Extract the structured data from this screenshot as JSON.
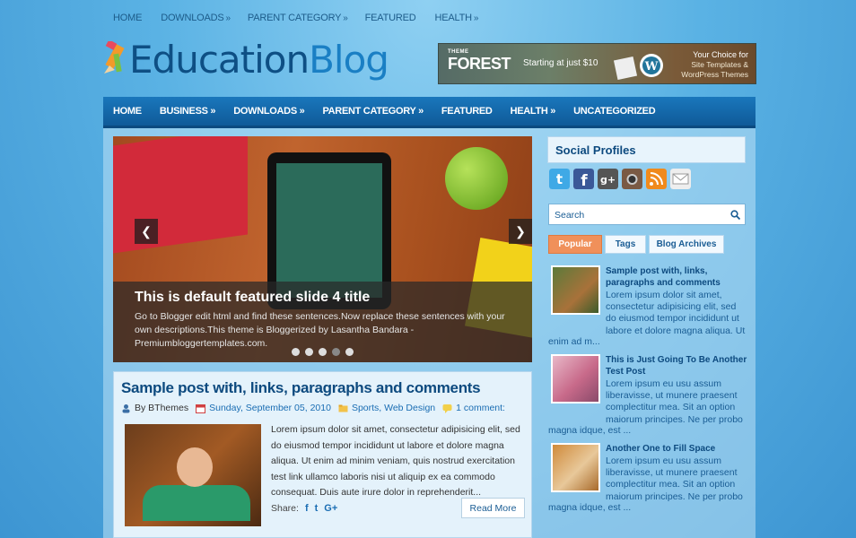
{
  "topnav": [
    {
      "label": "HOME",
      "arrow": ""
    },
    {
      "label": "DOWNLOADS",
      "arrow": "»"
    },
    {
      "label": "PARENT CATEGORY",
      "arrow": "»"
    },
    {
      "label": "FEATURED",
      "arrow": ""
    },
    {
      "label": "HEALTH",
      "arrow": "»"
    }
  ],
  "logo": {
    "part1": "Education",
    "part2": "Blog"
  },
  "ad": {
    "brand_small": "THEME",
    "brand_big": "FOREST",
    "start": "Starting at just $10",
    "choice_head": "Your Choice for",
    "choice_line1": "Site Templates &",
    "choice_line2": "WordPress Themes"
  },
  "mainnav": [
    "HOME",
    "BUSINESS »",
    "DOWNLOADS »",
    "PARENT CATEGORY »",
    "FEATURED",
    "HEALTH »",
    "UNCATEGORIZED"
  ],
  "slider": {
    "title": "This is default featured slide 4 title",
    "text": "Go to Blogger edit html and find these sentences.Now replace these sentences with your own descriptions.This theme is Bloggerized by Lasantha Bandara - Premiumbloggertemplates.com.",
    "left_arrow": "❮",
    "right_arrow": "❯",
    "dot_count": 5,
    "active_dot": 4
  },
  "post": {
    "title": "Sample post with, links, paragraphs and comments",
    "author": "By BThemes",
    "date": "Sunday, September 05, 2010",
    "categories": "Sports, Web Design",
    "comments": "1 comment:",
    "excerpt": "Lorem ipsum dolor sit amet, consectetur adipisicing elit, sed do eiusmod tempor incididunt ut labore et dolore magna aliqua. Ut enim ad minim veniam, quis nostrud exercitation test link ullamco laboris nisi ut aliquip ex ea commodo consequat. Duis aute irure dolor in reprehenderit...",
    "share_label": "Share:",
    "share_f": "f",
    "share_t": "t",
    "share_g": "G+",
    "read_more": "Read More"
  },
  "sidebar": {
    "social_title": "Social Profiles",
    "search_placeholder": "Search",
    "tabs": [
      "Popular",
      "Tags",
      "Blog Archives"
    ],
    "posts": [
      {
        "title": "Sample post with, links, paragraphs and comments",
        "text": "Lorem ipsum dolor sit amet, consectetur adipisicing elit, sed do eiusmod tempor incididunt ut labore et dolore magna aliqua. Ut",
        "tail": "enim ad m..."
      },
      {
        "title": "This is Just Going To Be Another Test Post",
        "text": "Lorem ipsum eu usu assum liberavisse, ut munere praesent complectitur mea. Sit an option maiorum principes. Ne per probo",
        "tail": "magna idque, est ..."
      },
      {
        "title": "Another One to Fill Space",
        "text": "Lorem ipsum eu usu assum liberavisse, ut munere praesent complectitur mea. Sit an option maiorum principes. Ne per probo",
        "tail": "magna idque, est ..."
      }
    ]
  },
  "colors": {
    "nav": "#0f5a98",
    "accent_tab": "#f0905a",
    "title": "#0d4a7f"
  }
}
